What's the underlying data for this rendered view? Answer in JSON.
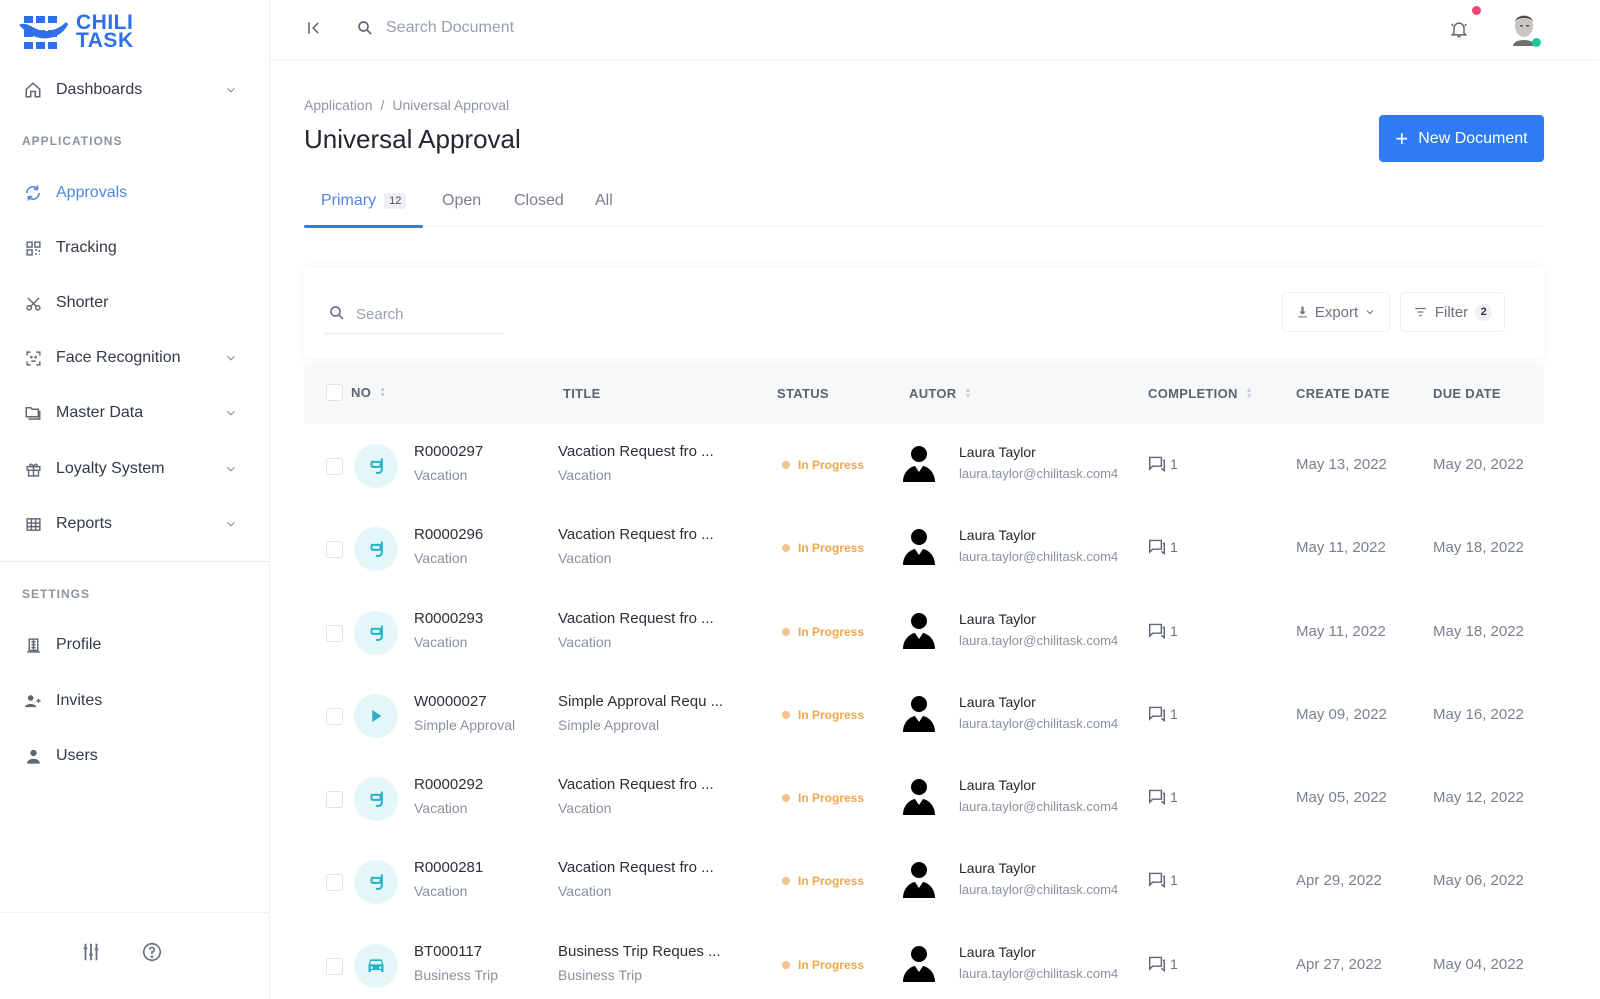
{
  "brand": {
    "name_line1": "CHILI",
    "name_line2": "TASK",
    "color": "#2f6fe9"
  },
  "sidebar": {
    "top_items": [
      {
        "label": "Dashboards",
        "icon": "home-icon",
        "expandable": true
      }
    ],
    "applications_label": "APPLICATIONS",
    "applications": [
      {
        "label": "Approvals",
        "icon": "sync-icon",
        "active": true
      },
      {
        "label": "Tracking",
        "icon": "qr-code-icon"
      },
      {
        "label": "Shorter",
        "icon": "scissors-icon"
      },
      {
        "label": "Face Recognition",
        "icon": "face-scan-icon",
        "expandable": true
      },
      {
        "label": "Master Data",
        "icon": "folders-icon",
        "expandable": true
      },
      {
        "label": "Loyalty System",
        "icon": "gift-icon",
        "expandable": true
      },
      {
        "label": "Reports",
        "icon": "table-grid-icon",
        "expandable": true
      }
    ],
    "settings_label": "SETTINGS",
    "settings": [
      {
        "label": "Profile",
        "icon": "building-icon"
      },
      {
        "label": "Invites",
        "icon": "user-plus-icon"
      },
      {
        "label": "Users",
        "icon": "user-icon"
      }
    ],
    "footer": {
      "settings_icon": "sliders-icon",
      "help_icon": "help-circle-icon"
    }
  },
  "topbar": {
    "search_placeholder": "Search Document",
    "notification_dot_color": "#ef476f",
    "online_dot_color": "#1cc8a0"
  },
  "page": {
    "breadcrumb": [
      "Application",
      "Universal Approval"
    ],
    "breadcrumb_separator": "/",
    "title": "Universal Approval",
    "new_button": {
      "label": "New Document",
      "icon": "+",
      "color": "#2f7bf2"
    },
    "tabs": [
      {
        "label": "Primary",
        "badge": "12",
        "active": true
      },
      {
        "label": "Open"
      },
      {
        "label": "Closed"
      },
      {
        "label": "All"
      }
    ]
  },
  "toolbar": {
    "search_placeholder": "Search",
    "export_label": "Export",
    "filter_label": "Filter",
    "filter_count": "2"
  },
  "table": {
    "columns": [
      "NO",
      "TITLE",
      "STATUS",
      "AUTOR",
      "COMPLETION",
      "CREATE DATE",
      "DUE DATE"
    ],
    "rows": [
      {
        "no": "R0000297",
        "type": "Vacation",
        "type_icon": "snorkel-icon",
        "title": "Vacation Request fro ...",
        "title_sub": "Vacation",
        "status": "In Progress",
        "author": "Laura Taylor",
        "email": "laura.taylor@chilitask.com4",
        "comments": "1",
        "create_date": "May 13, 2022",
        "due_date": "May 20, 2022"
      },
      {
        "no": "R0000296",
        "type": "Vacation",
        "type_icon": "snorkel-icon",
        "title": "Vacation Request fro ...",
        "title_sub": "Vacation",
        "status": "In Progress",
        "author": "Laura Taylor",
        "email": "laura.taylor@chilitask.com4",
        "comments": "1",
        "create_date": "May 11, 2022",
        "due_date": "May 18, 2022"
      },
      {
        "no": "R0000293",
        "type": "Vacation",
        "type_icon": "snorkel-icon",
        "title": "Vacation Request fro ...",
        "title_sub": "Vacation",
        "status": "In Progress",
        "author": "Laura Taylor",
        "email": "laura.taylor@chilitask.com4",
        "comments": "1",
        "create_date": "May 11, 2022",
        "due_date": "May 18, 2022"
      },
      {
        "no": "W0000027",
        "type": "Simple Approval",
        "type_icon": "play-icon",
        "title": "Simple Approval Requ ...",
        "title_sub": "Simple Approval",
        "status": "In Progress",
        "author": "Laura Taylor",
        "email": "laura.taylor@chilitask.com4",
        "comments": "1",
        "create_date": "May 09, 2022",
        "due_date": "May 16, 2022"
      },
      {
        "no": "R0000292",
        "type": "Vacation",
        "type_icon": "snorkel-icon",
        "title": "Vacation Request fro ...",
        "title_sub": "Vacation",
        "status": "In Progress",
        "author": "Laura Taylor",
        "email": "laura.taylor@chilitask.com4",
        "comments": "1",
        "create_date": "May 05, 2022",
        "due_date": "May 12, 2022"
      },
      {
        "no": "R0000281",
        "type": "Vacation",
        "type_icon": "snorkel-icon",
        "title": "Vacation Request fro ...",
        "title_sub": "Vacation",
        "status": "In Progress",
        "author": "Laura Taylor",
        "email": "laura.taylor@chilitask.com4",
        "comments": "1",
        "create_date": "Apr 29, 2022",
        "due_date": "May 06, 2022"
      },
      {
        "no": "BT000117",
        "type": "Business Trip",
        "type_icon": "car-icon",
        "title": "Business Trip Reques ...",
        "title_sub": "Business Trip",
        "status": "In Progress",
        "author": "Laura Taylor",
        "email": "laura.taylor@chilitask.com4",
        "comments": "1",
        "create_date": "Apr 27, 2022",
        "due_date": "May 04, 2022"
      }
    ],
    "status_color": "#f0a64d"
  }
}
